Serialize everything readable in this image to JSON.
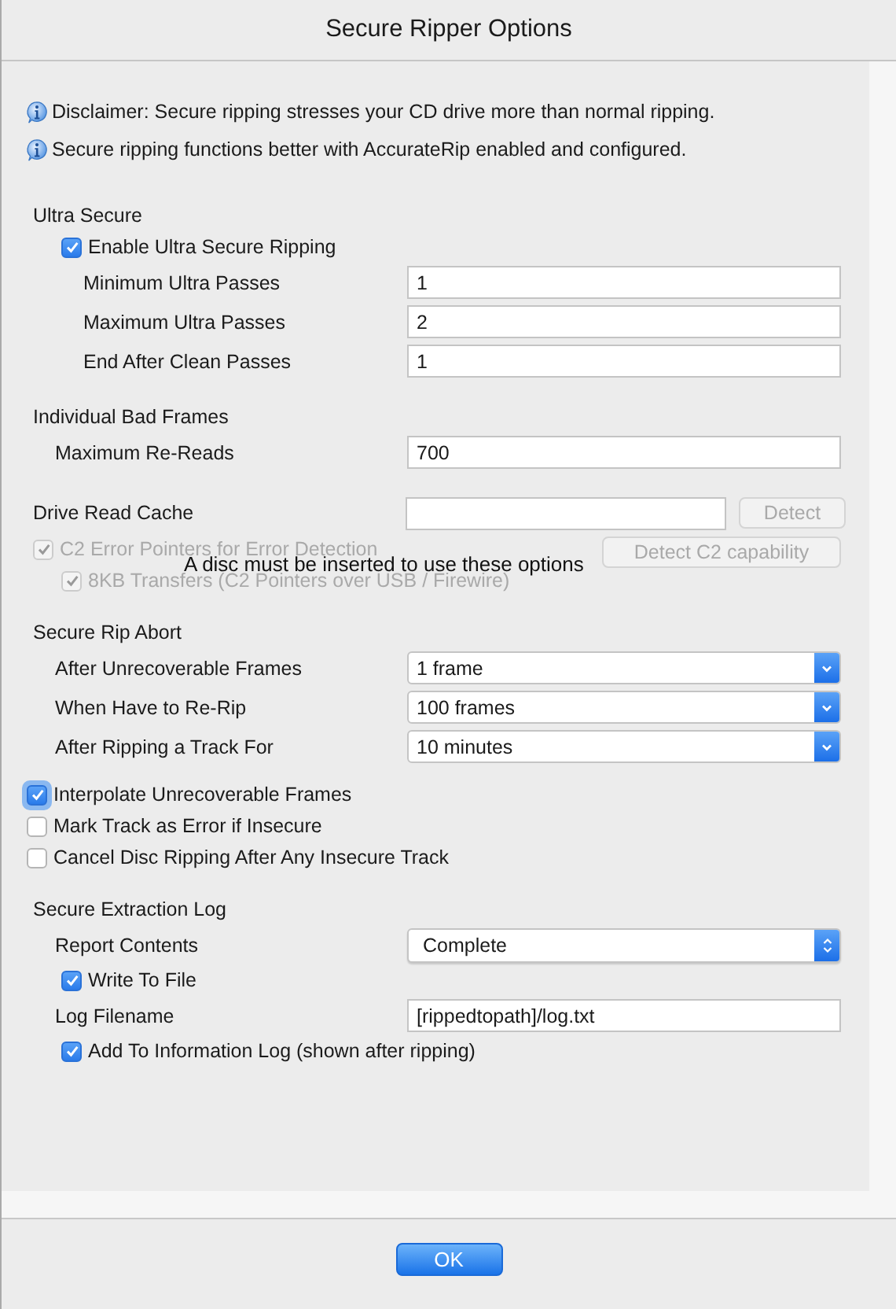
{
  "window": {
    "title": "Secure Ripper Options"
  },
  "notices": [
    {
      "text": "Disclaimer: Secure ripping stresses your CD drive more than normal ripping."
    },
    {
      "text": "Secure ripping functions better with AccurateRip enabled and configured."
    }
  ],
  "sections": [
    {
      "kind": "plain",
      "title": "Ultra Secure",
      "items": [
        {
          "kind": "checkbox",
          "label": "Enable Ultra Secure Ripping",
          "checked": true,
          "disabled": false,
          "focused": false,
          "children": [
            {
              "kind": "field",
              "label": "Minimum Ultra Passes",
              "value": "1"
            },
            {
              "kind": "field",
              "label": "Maximum Ultra Passes",
              "value": "2"
            },
            {
              "kind": "field",
              "label": "End After Clean Passes",
              "value": "1"
            }
          ]
        }
      ]
    },
    {
      "kind": "plain",
      "title": "Individual Bad Frames",
      "items": [
        {
          "kind": "field",
          "label": "Maximum Re-Reads",
          "value": "700"
        }
      ]
    },
    {
      "kind": "cache",
      "title": "Drive Read Cache",
      "button": {
        "label": "Detect",
        "disabled": true
      },
      "side_button": {
        "label": "Detect C2 capability",
        "disabled": true
      },
      "note": "A disc must be inserted to use these options",
      "items": [
        {
          "kind": "checkbox",
          "label": "C2 Error Pointers for Error Detection",
          "checked": true,
          "disabled": true,
          "focused": false,
          "children": [
            {
              "kind": "checkbox",
              "label": "8KB Transfers (C2 Pointers over USB / Firewire)",
              "checked": true,
              "disabled": true,
              "focused": false
            }
          ]
        }
      ]
    },
    {
      "kind": "plain",
      "title": "Secure Rip Abort",
      "items": [
        {
          "kind": "dropdown",
          "label": "After Unrecoverable Frames",
          "value": "1 frame"
        },
        {
          "kind": "dropdown",
          "label": "When Have to Re-Rip",
          "value": "100 frames"
        },
        {
          "kind": "dropdown",
          "label": "After Ripping a Track For",
          "value": "10 minutes"
        }
      ]
    },
    {
      "kind": "options",
      "items": [
        {
          "kind": "checkbox",
          "label": "Interpolate Unrecoverable Frames",
          "checked": true,
          "disabled": false,
          "focused": true
        },
        {
          "kind": "checkbox",
          "label": "Mark Track as Error if Insecure",
          "checked": false,
          "disabled": false,
          "focused": false
        },
        {
          "kind": "checkbox",
          "label": "Cancel Disc Ripping After Any Insecure Track",
          "checked": false,
          "disabled": false,
          "focused": false
        }
      ]
    },
    {
      "kind": "plain",
      "title": "Secure Extraction Log",
      "items": [
        {
          "kind": "popup",
          "label": "Report Contents",
          "value": "Complete"
        },
        {
          "kind": "checkbox",
          "label": "Write To File",
          "checked": true,
          "disabled": false,
          "focused": false
        },
        {
          "kind": "field",
          "label": "Log Filename",
          "value": "[rippedtopath]/log.txt"
        },
        {
          "kind": "checkbox",
          "label": "Add To Information Log (shown after ripping)",
          "checked": true,
          "disabled": false,
          "focused": false
        }
      ]
    }
  ],
  "buttons": [
    {
      "label": "OK",
      "default": true
    }
  ]
}
